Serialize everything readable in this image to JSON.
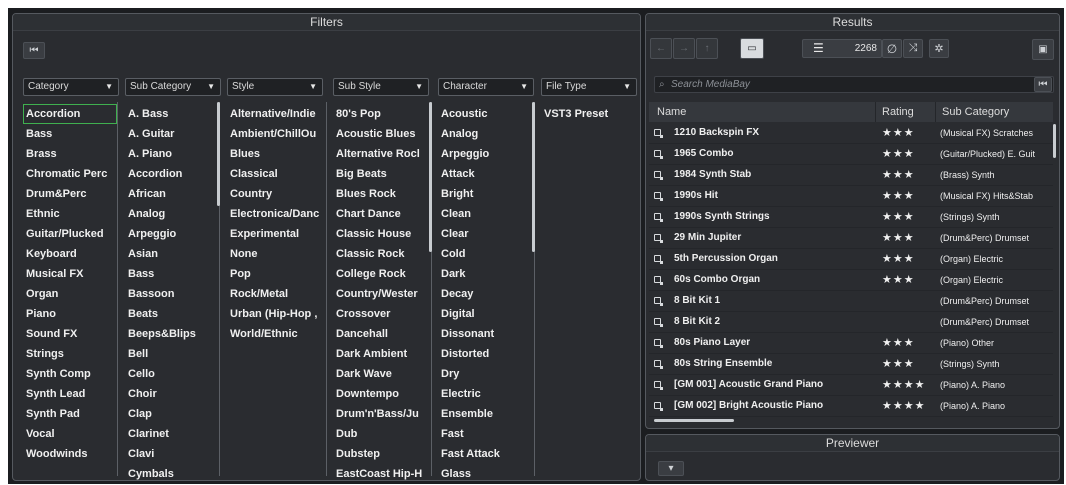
{
  "filters": {
    "title": "Filters",
    "reset_label": "⏮",
    "columns": [
      {
        "header": "Category",
        "items": [
          "Accordion",
          "Bass",
          "Brass",
          "Chromatic Perc",
          "Drum&Perc",
          "Ethnic",
          "Guitar/Plucked",
          "Keyboard",
          "Musical FX",
          "Organ",
          "Piano",
          "Sound FX",
          "Strings",
          "Synth Comp",
          "Synth Lead",
          "Synth Pad",
          "Vocal",
          "Woodwinds"
        ]
      },
      {
        "header": "Sub Category",
        "items": [
          "A. Bass",
          "A. Guitar",
          "A. Piano",
          "Accordion",
          "African",
          "Analog",
          "Arpeggio",
          "Asian",
          "Bass",
          "Bassoon",
          "Beats",
          "Beeps&Blips",
          "Bell",
          "Cello",
          "Choir",
          "Clap",
          "Clarinet",
          "Clavi",
          "Cymbals"
        ]
      },
      {
        "header": "Style",
        "items": [
          "Alternative/Indie",
          "Ambient/ChillOu",
          "Blues",
          "Classical",
          "Country",
          "Electronica/Danc",
          "Experimental",
          "None",
          "Pop",
          "Rock/Metal",
          "Urban (Hip-Hop ,",
          "World/Ethnic"
        ]
      },
      {
        "header": "Sub Style",
        "items": [
          "80's Pop",
          "Acoustic Blues",
          "Alternative Rocl",
          "Big Beats",
          "Blues Rock",
          "Chart Dance",
          "Classic House",
          "Classic Rock",
          "College Rock",
          "Country/Wester",
          "Crossover",
          "Dancehall",
          "Dark Ambient",
          "Dark Wave",
          "Downtempo",
          "Drum'n'Bass/Ju",
          "Dub",
          "Dubstep",
          "EastCoast Hip-H"
        ]
      },
      {
        "header": "Character",
        "items": [
          "Acoustic",
          "Analog",
          "Arpeggio",
          "Attack",
          "Bright",
          "Clean",
          "Clear",
          "Cold",
          "Dark",
          "Decay",
          "Digital",
          "Dissonant",
          "Distorted",
          "Dry",
          "Electric",
          "Ensemble",
          "Fast",
          "Fast Attack",
          "Glass"
        ]
      },
      {
        "header": "File Type",
        "items": [
          "VST3 Preset"
        ]
      }
    ]
  },
  "results": {
    "title": "Results",
    "count": "2268",
    "search_placeholder": "Search MediaBay",
    "columns": {
      "name": "Name",
      "rating": "Rating",
      "sub": "Sub Category"
    },
    "rows": [
      {
        "name": "1210 Backspin FX",
        "rating": "★★★",
        "sub": "(Musical FX) Scratches"
      },
      {
        "name": "1965 Combo",
        "rating": "★★★",
        "sub": "(Guitar/Plucked) E. Guit"
      },
      {
        "name": "1984 Synth Stab",
        "rating": "★★★",
        "sub": "(Brass) Synth"
      },
      {
        "name": "1990s Hit",
        "rating": "★★★",
        "sub": "(Musical FX) Hits&Stab"
      },
      {
        "name": "1990s Synth Strings",
        "rating": "★★★",
        "sub": "(Strings) Synth"
      },
      {
        "name": "29 Min Jupiter",
        "rating": "★★★",
        "sub": "(Drum&Perc) Drumset"
      },
      {
        "name": "5th Percussion Organ",
        "rating": "★★★",
        "sub": "(Organ) Electric"
      },
      {
        "name": "60s Combo Organ",
        "rating": "★★★",
        "sub": "(Organ) Electric"
      },
      {
        "name": "8 Bit Kit 1",
        "rating": "",
        "sub": "(Drum&Perc) Drumset"
      },
      {
        "name": "8 Bit Kit 2",
        "rating": "",
        "sub": "(Drum&Perc) Drumset"
      },
      {
        "name": "80s Piano Layer",
        "rating": "★★★",
        "sub": "(Piano) Other"
      },
      {
        "name": "80s String Ensemble",
        "rating": "★★★",
        "sub": "(Strings) Synth"
      },
      {
        "name": "[GM 001] Acoustic Grand Piano",
        "rating": "★★★★",
        "sub": "(Piano) A. Piano"
      },
      {
        "name": "[GM 002] Bright Acoustic Piano",
        "rating": "★★★★",
        "sub": "(Piano) A. Piano"
      }
    ]
  },
  "previewer": {
    "title": "Previewer"
  }
}
